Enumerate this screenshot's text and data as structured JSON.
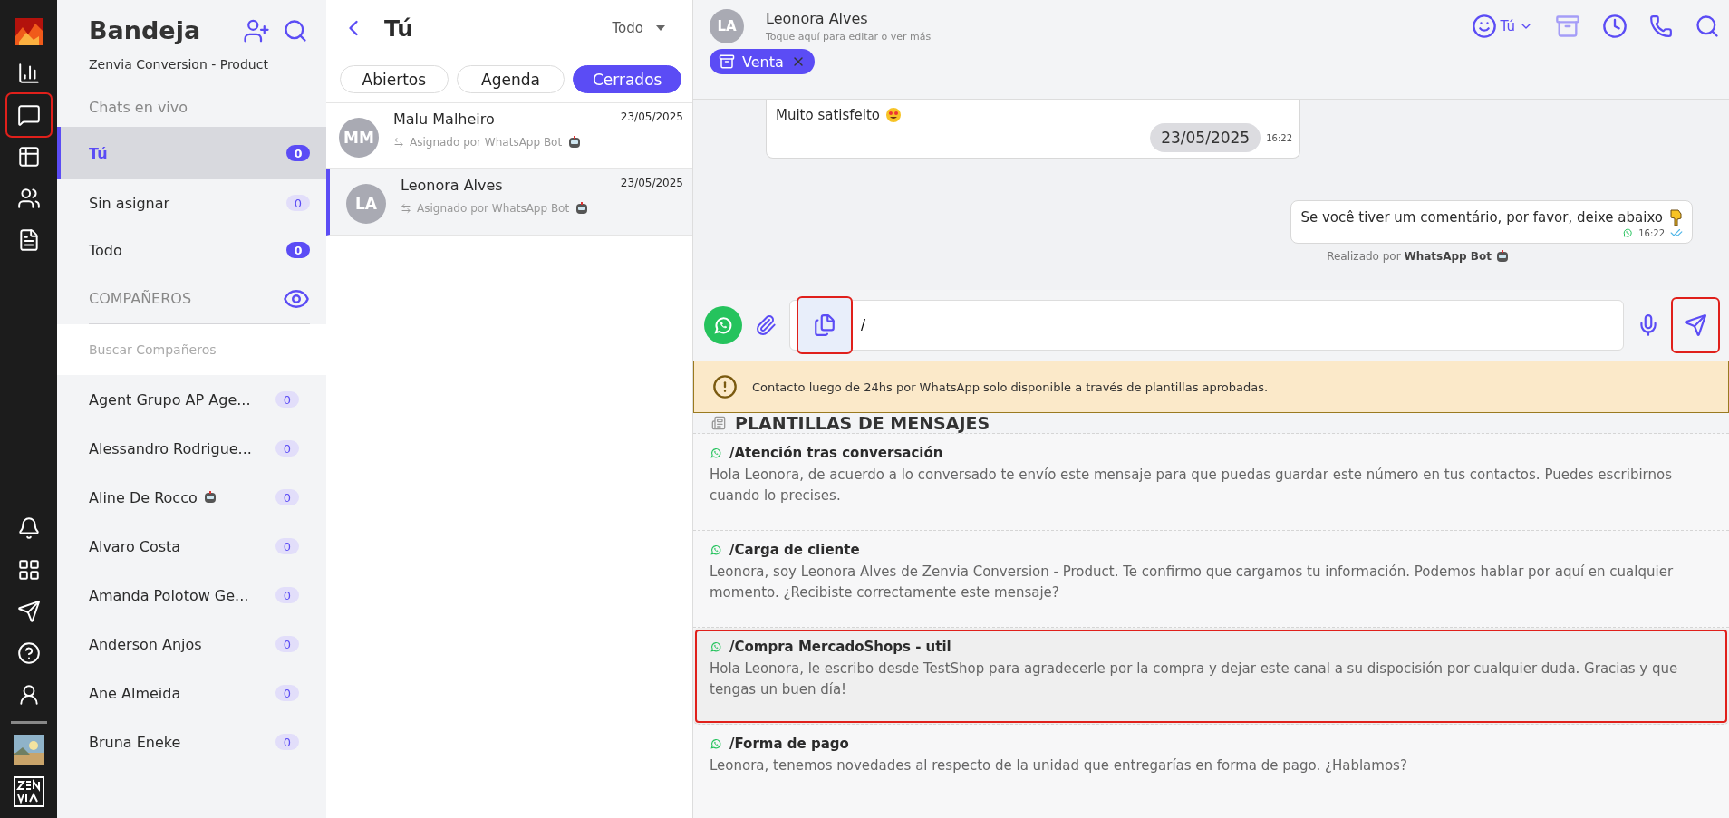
{
  "rail": {
    "chat_highlighted": true
  },
  "inbox": {
    "title": "Bandeja",
    "subtitle": "Zenvia Conversion - Product",
    "section_label": "Chats en vivo",
    "views": [
      {
        "label": "Tú",
        "count": "0",
        "selected": true,
        "badge_filled": true
      },
      {
        "label": "Sin asignar",
        "count": "0",
        "selected": false,
        "badge_filled": false
      },
      {
        "label": "Todo",
        "count": "0",
        "selected": false,
        "badge_filled": true
      }
    ],
    "teammates_label": "COMPAÑEROS",
    "teammate_search": {
      "placeholder": "Buscar Compañeros"
    },
    "teammates": [
      {
        "name": "Agent Grupo AP Age...",
        "count": "0",
        "bot": false
      },
      {
        "name": "Alessandro Rodrigue...",
        "count": "0",
        "bot": false
      },
      {
        "name": "Aline De Rocco",
        "count": "0",
        "bot": true
      },
      {
        "name": "Alvaro Costa",
        "count": "0",
        "bot": false
      },
      {
        "name": "Amanda Polotow Ge...",
        "count": "0",
        "bot": false
      },
      {
        "name": "Anderson Anjos",
        "count": "0",
        "bot": false
      },
      {
        "name": "Ane Almeida",
        "count": "0",
        "bot": false
      },
      {
        "name": "Bruna Eneke",
        "count": "0",
        "bot": false
      }
    ]
  },
  "chat_list": {
    "title": "Tú",
    "filter": "Todo",
    "tabs": [
      {
        "label": "Abiertos",
        "selected": false
      },
      {
        "label": "Agenda",
        "selected": false
      },
      {
        "label": "Cerrados",
        "selected": true
      }
    ],
    "chats": [
      {
        "initials": "MM",
        "name": "Malu Malheiro",
        "date": "23/05/2025",
        "note": "Asignado por WhatsApp Bot",
        "selected": false
      },
      {
        "initials": "LA",
        "name": "Leonora Alves",
        "date": "23/05/2025",
        "note": "Asignado por WhatsApp Bot",
        "selected": true
      }
    ]
  },
  "conversation": {
    "contact": {
      "initials": "LA",
      "name": "Leonora Alves",
      "hint": "Toque aquí para editar o ver más"
    },
    "agent": "Tú",
    "tag": "Venta",
    "messages": [
      {
        "kind": "incoming",
        "text": "Muito satisfeito",
        "date_chip": "23/05/2025",
        "time": "16:22"
      },
      {
        "kind": "outgoing",
        "text": "Se você tiver um comentário, por favor, deixe abaixo",
        "time": "16:22",
        "read": true,
        "footer": "Realizado por **WhatsApp Bot**"
      }
    ],
    "composer": {
      "value": "/",
      "templates_highlighted": true,
      "send_highlighted": true
    },
    "warning": "Contacto luego de 24hs por WhatsApp solo disponible a través de plantillas aprobadas.",
    "templates": {
      "title": "PLANTILLAS DE MENSAJES",
      "items": [
        {
          "name": "/Atención tras conversación",
          "text": "Hola Leonora, de acuerdo a lo conversado te envío este mensaje para que puedas guardar este número en tus contactos. Puedes escribirnos cuando lo precises.",
          "highlighted": false
        },
        {
          "name": "/Carga de cliente",
          "text": "Leonora, soy Leonora Alves de Zenvia Conversion - Product. Te confirmo que cargamos tu información. Podemos hablar por aquí en cualquier momento. ¿Recibiste correctamente este mensaje?",
          "highlighted": false
        },
        {
          "name": "/Compra MercadoShops - util",
          "text": "Hola Leonora, le escribo desde TestShop para agradecerle por la compra y dejar este canal a su dispocisión por cualquier duda. Gracias y que tengas un buen día!",
          "highlighted": true
        },
        {
          "name": "/Forma de pago",
          "text": "Leonora, tenemos novedades al respecto de la unidad que entregarías en forma de pago. ¿Hablamos?",
          "highlighted": false
        }
      ]
    }
  }
}
